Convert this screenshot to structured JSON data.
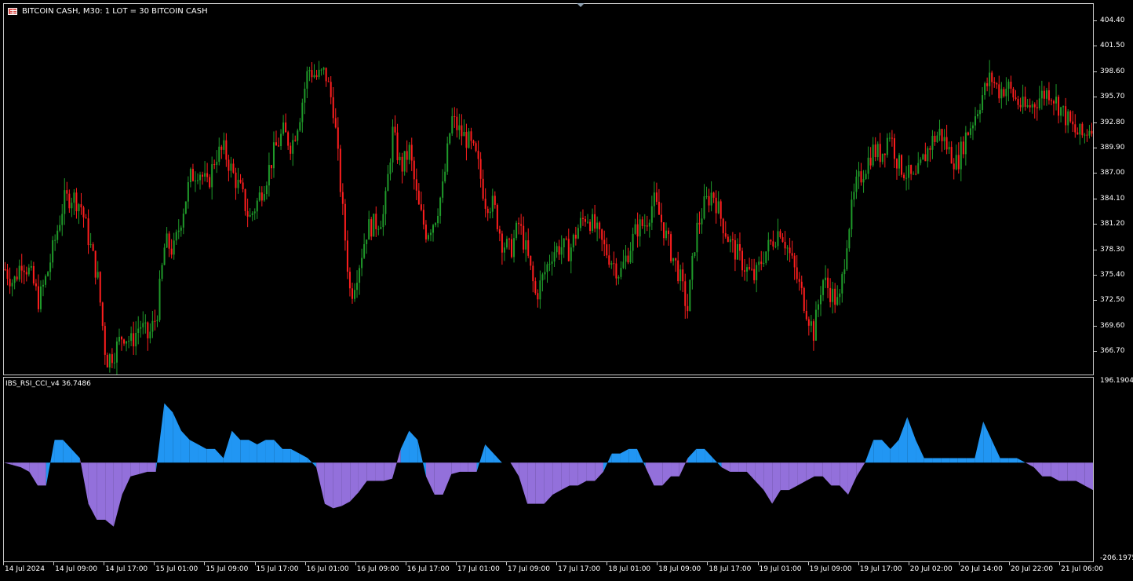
{
  "window": {
    "symbol_title": "BITCOIN CASH, M30:  1 LOT = 30 BITCOIN CASH",
    "flag_icon": "uk-flag-icon"
  },
  "indicator": {
    "title": "IBS_RSI_CCI_v4 36.7486"
  },
  "price_axis": {
    "labels": [
      "404.40",
      "401.50",
      "398.60",
      "395.70",
      "392.80",
      "389.90",
      "387.00",
      "384.10",
      "381.20",
      "378.30",
      "375.40",
      "372.50",
      "369.60",
      "366.70"
    ]
  },
  "indicator_axis": {
    "top": "196.1904",
    "bottom": "-206.1975"
  },
  "time_axis": {
    "labels": [
      "14 Jul 2024",
      "14 Jul 09:00",
      "14 Jul 17:00",
      "15 Jul 01:00",
      "15 Jul 09:00",
      "15 Jul 17:00",
      "16 Jul 01:00",
      "16 Jul 09:00",
      "16 Jul 17:00",
      "17 Jul 01:00",
      "17 Jul 09:00",
      "17 Jul 17:00",
      "18 Jul 01:00",
      "18 Jul 09:00",
      "18 Jul 17:00",
      "19 Jul 01:00",
      "19 Jul 09:00",
      "19 Jul 17:00",
      "20 Jul 02:00",
      "20 Jul 14:00",
      "20 Jul 22:00",
      "21 Jul 06:00"
    ]
  },
  "colors": {
    "bull": "#1f9a2a",
    "bear": "#ff1e1e",
    "blue_fill": "#2196f3",
    "purple_fill": "#9370db",
    "frame": "#c8c8c8"
  },
  "chart_data": [
    {
      "type": "candlestick",
      "title": "BITCOIN CASH, M30",
      "ylim": [
        365.5,
        406.0
      ],
      "path": [
        377.0,
        375.5,
        378.0,
        376.5,
        373.5,
        376.5,
        380.5,
        384.5,
        385.0,
        384.0,
        380.0,
        376.0,
        367.0,
        368.0,
        370.0,
        369.0,
        371.0,
        369.5,
        372.0,
        380.0,
        379.0,
        383.0,
        387.0,
        388.0,
        386.0,
        389.5,
        390.0,
        387.5,
        385.5,
        382.5,
        384.5,
        387.0,
        390.0,
        392.0,
        390.5,
        394.0,
        399.0,
        398.0,
        398.5,
        394.5,
        384.0,
        374.0,
        377.5,
        381.5,
        382.0,
        383.0,
        392.0,
        388.0,
        390.0,
        384.0,
        381.0,
        382.5,
        386.0,
        393.5,
        392.0,
        391.0,
        389.0,
        384.5,
        384.0,
        380.0,
        379.0,
        382.0,
        378.5,
        374.0,
        376.5,
        379.0,
        379.5,
        379.0,
        381.5,
        383.0,
        381.5,
        379.5,
        378.0,
        376.5,
        379.0,
        381.5,
        382.0,
        384.5,
        382.0,
        379.0,
        376.5,
        372.5,
        381.0,
        384.0,
        385.5,
        382.5,
        380.0,
        378.5,
        377.0,
        376.0,
        378.5,
        380.0,
        381.5,
        379.0,
        376.0,
        373.0,
        370.0,
        376.0,
        374.5,
        373.0,
        381.0,
        386.0,
        388.0,
        390.0,
        389.5,
        392.0,
        388.5,
        387.5,
        386.5,
        389.0,
        391.0,
        392.0,
        390.0,
        388.5,
        391.5,
        393.5,
        396.0,
        398.0,
        396.5,
        397.0,
        395.5,
        394.5,
        395.0,
        396.0,
        396.5,
        395.0,
        393.5,
        392.0,
        391.5,
        393.0
      ],
      "x_labels": [
        "14 Jul 2024",
        "14 Jul 09:00",
        "14 Jul 17:00",
        "15 Jul 01:00",
        "15 Jul 09:00",
        "15 Jul 17:00",
        "16 Jul 01:00",
        "16 Jul 09:00",
        "16 Jul 17:00",
        "17 Jul 01:00",
        "17 Jul 09:00",
        "17 Jul 17:00",
        "18 Jul 01:00",
        "18 Jul 09:00",
        "18 Jul 17:00",
        "19 Jul 01:00",
        "19 Jul 09:00",
        "19 Jul 17:00",
        "20 Jul 02:00",
        "20 Jul 14:00",
        "20 Jul 22:00",
        "21 Jul 06:00"
      ]
    },
    {
      "type": "area",
      "title": "IBS_RSI_CCI_v4 36.7486",
      "ylim": [
        -206.1975,
        196.1904
      ],
      "series": [
        {
          "values": [
            10,
            5,
            0,
            -10,
            -40,
            -40,
            60,
            60,
            40,
            20,
            -80,
            -115,
            -115,
            -130,
            -60,
            -20,
            -15,
            -10,
            -10,
            140,
            120,
            80,
            60,
            50,
            40,
            40,
            20,
            80,
            60,
            60,
            50,
            60,
            60,
            40,
            40,
            30,
            20,
            0,
            -80,
            -90,
            -85,
            -75,
            -55,
            -30,
            -30,
            -30,
            -25,
            40,
            80,
            60,
            -20,
            -60,
            -60,
            -15,
            -10,
            -10,
            -10,
            50,
            30,
            10,
            10,
            -20,
            -80,
            -80,
            -80,
            -60,
            -50,
            -40,
            -40,
            -30,
            -30,
            -10,
            30,
            30,
            40,
            40,
            0,
            -40,
            -40,
            -20,
            -20,
            20,
            40,
            40,
            20,
            0,
            -10,
            -10,
            -10,
            -30,
            -50,
            -80,
            -50,
            -50,
            -40,
            -30,
            -20,
            -20,
            -40,
            -40,
            -60,
            -20,
            10,
            60,
            60,
            40,
            60,
            110,
            60,
            20,
            20,
            20,
            20,
            20,
            20,
            20,
            100,
            60,
            20,
            20,
            20,
            10,
            0,
            -20,
            -20,
            -30,
            -30,
            -30,
            -40,
            -50
          ]
        }
      ]
    }
  ]
}
